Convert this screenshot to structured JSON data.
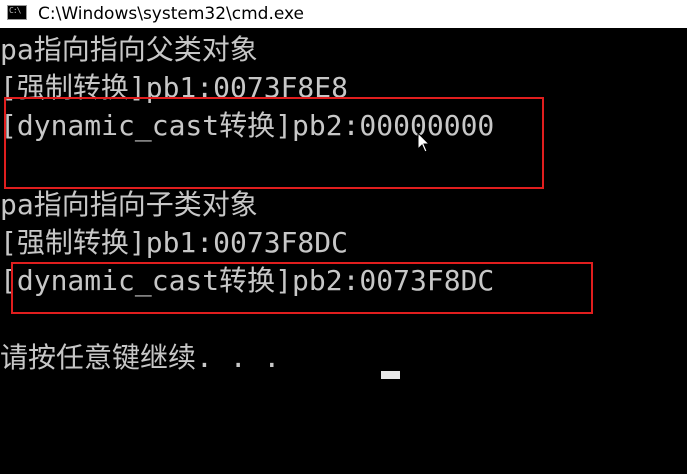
{
  "window": {
    "title": "C:\\Windows\\system32\\cmd.exe",
    "icon_text": "C:\\"
  },
  "console": {
    "lines": [
      "pa指向指向父类对象",
      "[强制转换]pb1:0073F8E8",
      "[dynamic_cast转换]pb2:00000000",
      "pa指向指向子类对象",
      "[强制转换]pb1:0073F8DC",
      "[dynamic_cast转换]pb2:0073F8DC",
      "请按任意键继续. . ."
    ]
  },
  "colors": {
    "background": "#000000",
    "text": "#c7c7c7",
    "annotation": "#e01e1e"
  }
}
